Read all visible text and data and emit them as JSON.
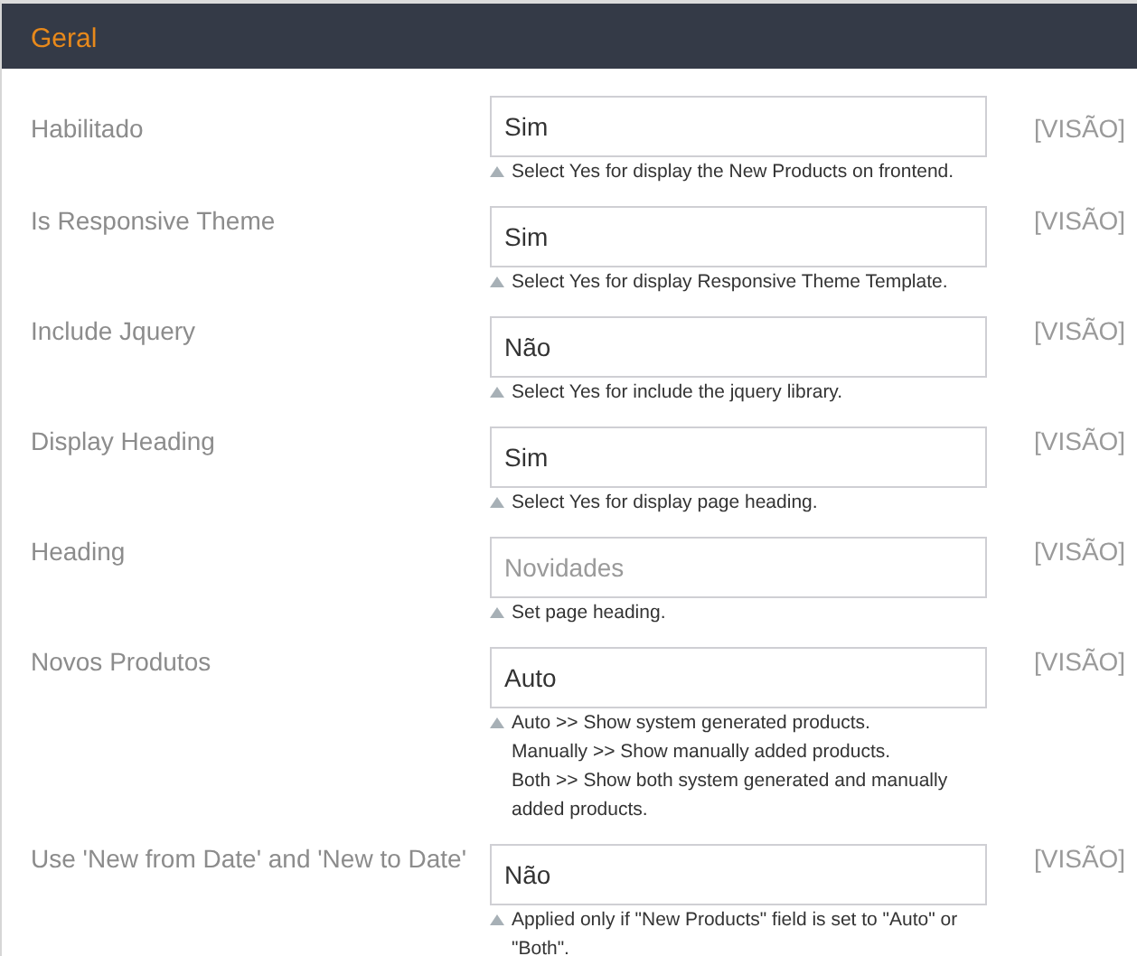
{
  "section": {
    "title": "Geral"
  },
  "rows": [
    {
      "label": "Habilitado",
      "kind": "select",
      "value": "Sim",
      "scope": "[VISÃO]",
      "hint": [
        "Select Yes for display the New Products on frontend."
      ]
    },
    {
      "label": "Is Responsive Theme",
      "kind": "select",
      "value": "Sim",
      "scope": "[VISÃO]",
      "hint": [
        "Select Yes for display Responsive Theme Template."
      ]
    },
    {
      "label": "Include Jquery",
      "kind": "select",
      "value": "Não",
      "scope": "[VISÃO]",
      "hint": [
        "Select Yes for include the jquery library."
      ]
    },
    {
      "label": "Display Heading",
      "kind": "select",
      "value": "Sim",
      "scope": "[VISÃO]",
      "hint": [
        "Select Yes for display page heading."
      ]
    },
    {
      "label": "Heading",
      "kind": "text",
      "placeholder": "Novidades",
      "scope": "[VISÃO]",
      "hint": [
        "Set page heading."
      ]
    },
    {
      "label": "Novos Produtos",
      "kind": "select",
      "value": "Auto",
      "scope": "[VISÃO]",
      "hint": [
        "Auto >> Show system generated products.",
        "Manually >> Show manually added products.",
        "Both >> Show both system generated and manually added products."
      ]
    },
    {
      "label": "Use 'New from Date' and 'New to Date'",
      "kind": "select",
      "value": "Não",
      "scope": "[VISÃO]",
      "hint": [
        "Applied only if \"New Products\" field is set to \"Auto\" or \"Both\"."
      ]
    }
  ]
}
